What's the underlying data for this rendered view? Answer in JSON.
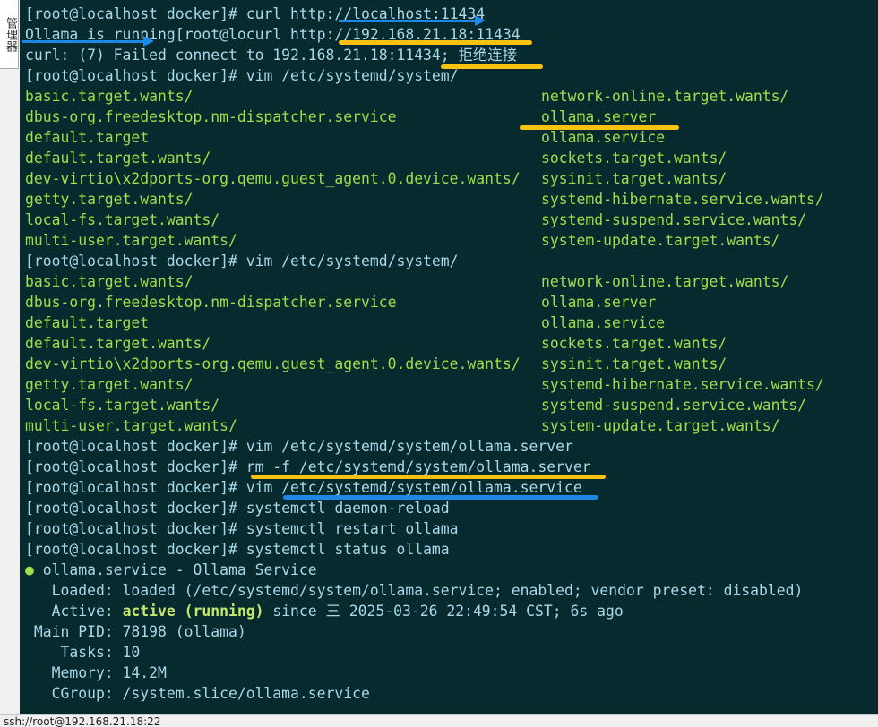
{
  "side_tab": {
    "label": "管理器"
  },
  "status_bar": {
    "text": "ssh://root@192.168.21.18:22"
  },
  "terminal": {
    "l1": {
      "prompt": "[root@localhost docker]# ",
      "cmd": "curl http://localhost:11434"
    },
    "l2": {
      "text": "Ollama is running[root@locurl http://192.168.21.18:11434"
    },
    "l3": {
      "text": "curl: (7) Failed connect to 192.168.21.18:11434; ",
      "cn": "拒绝连接"
    },
    "l4": {
      "prompt": "[root@localhost docker]# ",
      "cmd": "vim /etc/systemd/system/"
    },
    "listing1": [
      [
        "basic.target.wants/",
        "network-online.target.wants/"
      ],
      [
        "dbus-org.freedesktop.nm-dispatcher.service",
        "ollama.server"
      ],
      [
        "default.target",
        "ollama.service"
      ],
      [
        "default.target.wants/",
        "sockets.target.wants/"
      ],
      [
        "dev-virtio\\x2dports-org.qemu.guest_agent.0.device.wants/",
        "sysinit.target.wants/"
      ],
      [
        "getty.target.wants/",
        "systemd-hibernate.service.wants/"
      ],
      [
        "local-fs.target.wants/",
        "systemd-suspend.service.wants/"
      ],
      [
        "multi-user.target.wants/",
        "system-update.target.wants/"
      ]
    ],
    "l13": {
      "prompt": "[root@localhost docker]# ",
      "cmd": "vim /etc/systemd/system/"
    },
    "listing2": [
      [
        "basic.target.wants/",
        "network-online.target.wants/"
      ],
      [
        "dbus-org.freedesktop.nm-dispatcher.service",
        "ollama.server"
      ],
      [
        "default.target",
        "ollama.service"
      ],
      [
        "default.target.wants/",
        "sockets.target.wants/"
      ],
      [
        "dev-virtio\\x2dports-org.qemu.guest_agent.0.device.wants/",
        "sysinit.target.wants/"
      ],
      [
        "getty.target.wants/",
        "systemd-hibernate.service.wants/"
      ],
      [
        "local-fs.target.wants/",
        "systemd-suspend.service.wants/"
      ],
      [
        "multi-user.target.wants/",
        "system-update.target.wants/"
      ]
    ],
    "l22": {
      "prompt": "[root@localhost docker]# ",
      "cmd": "vim /etc/systemd/system/ollama.server"
    },
    "l23": {
      "prompt": "[root@localhost docker]# ",
      "cmd": "rm -f /etc/systemd/system/ollama.server"
    },
    "l24": {
      "prompt": "[root@localhost docker]# ",
      "cmd": "vim /etc/systemd/system/ollama.service"
    },
    "l25": {
      "prompt": "[root@localhost docker]# ",
      "cmd": "systemctl daemon-reload"
    },
    "l26": {
      "prompt": "[root@localhost docker]# ",
      "cmd": "systemctl restart ollama"
    },
    "l27": {
      "prompt": "[root@localhost docker]# ",
      "cmd": "systemctl status ollama"
    },
    "status": {
      "dot": "●",
      "title": " ollama.service - Ollama Service",
      "loaded": "   Loaded: loaded (/etc/systemd/system/ollama.service; enabled; vendor preset: disabled)",
      "active_label": "   Active: ",
      "active_value": "active (running)",
      "active_rest": " since 三 2025-03-26 22:49:54 CST; 6s ago",
      "pid": " Main PID: 78198 (ollama)",
      "tasks": "    Tasks: 10",
      "memory": "   Memory: 14.2M",
      "cgroup": "   CGroup: /system.slice/ollama.service"
    }
  },
  "colors": {
    "background": "#062a2e",
    "text": "#a8d8ea",
    "listing": "#9de04a",
    "highlight_yellow": "#f7c211",
    "highlight_blue": "#1e88e5"
  }
}
